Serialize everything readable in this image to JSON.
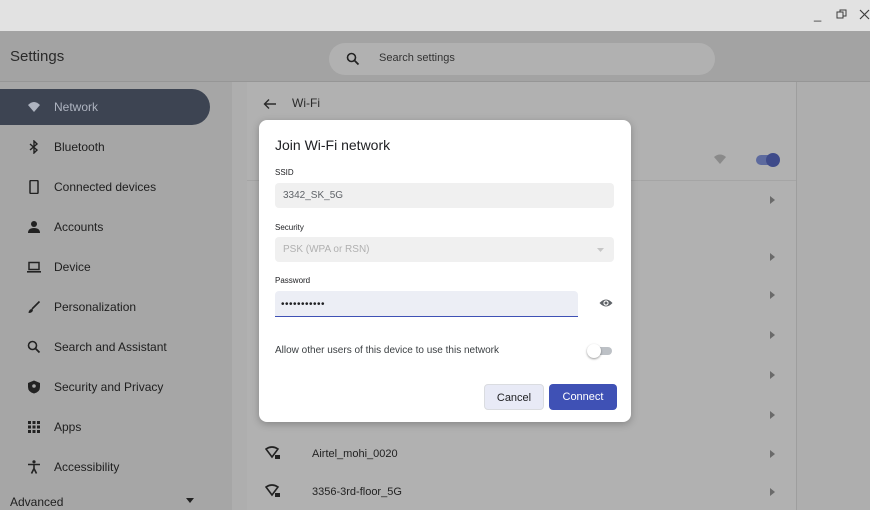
{
  "window": {
    "minimize_icon": "minimize-icon",
    "restore_icon": "restore-icon",
    "close_icon": "close-icon"
  },
  "header": {
    "title": "Settings",
    "search": {
      "placeholder": "Search settings",
      "icon": "search-icon"
    }
  },
  "sidebar": {
    "items": [
      {
        "label": "Network",
        "icon": "wifi-icon",
        "active": true
      },
      {
        "label": "Bluetooth",
        "icon": "bluetooth-icon"
      },
      {
        "label": "Connected devices",
        "icon": "phone-icon"
      },
      {
        "label": "Accounts",
        "icon": "person-icon"
      },
      {
        "label": "Device",
        "icon": "laptop-icon"
      },
      {
        "label": "Personalization",
        "icon": "brush-icon"
      },
      {
        "label": "Search and Assistant",
        "icon": "search-icon"
      },
      {
        "label": "Security and Privacy",
        "icon": "shield-icon"
      },
      {
        "label": "Apps",
        "icon": "apps-grid-icon"
      },
      {
        "label": "Accessibility",
        "icon": "accessibility-icon"
      }
    ],
    "advanced_label": "Advanced"
  },
  "main": {
    "page_title": "Wi-Fi",
    "wifi_enabled": true,
    "networks": [
      {
        "name": "Airtel_mohi_0020",
        "icon": "wifi-secured-icon"
      },
      {
        "name": "3356-3rd-floor_5G",
        "icon": "wifi-secured-icon"
      }
    ]
  },
  "dialog": {
    "title": "Join Wi-Fi network",
    "ssid_label": "SSID",
    "ssid_value": "3342_SK_5G",
    "security_label": "Security",
    "security_value": "PSK (WPA or RSN)",
    "password_label": "Password",
    "password_value": "•••••••••••",
    "share_label": "Allow other users of this device to use this network",
    "share_enabled": false,
    "cancel_label": "Cancel",
    "connect_label": "Connect"
  },
  "colors": {
    "accent": "#3f51b5",
    "active_nav_bg": "#3d4452",
    "overlay_bg": "#aeaeae",
    "dialog_bg": "#ffffff"
  }
}
